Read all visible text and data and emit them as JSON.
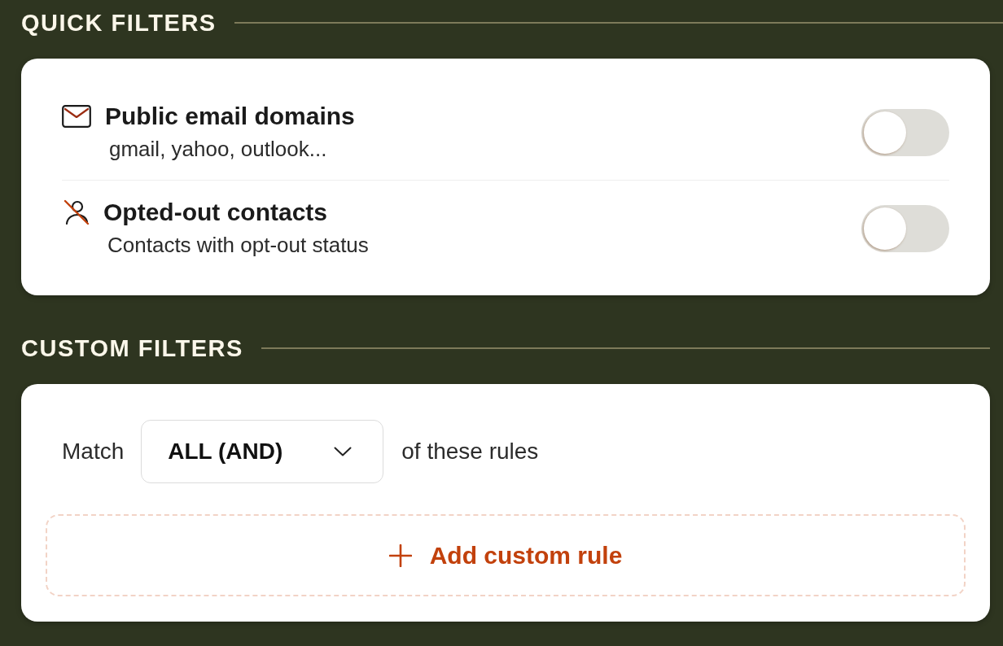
{
  "sections": [
    {
      "kind": "quick",
      "title": "QUICK FILTERS",
      "filters": [
        {
          "title": "Public email domains",
          "subtitle": "gmail, yahoo, outlook...",
          "on": false
        },
        {
          "title": "Opted-out contacts",
          "subtitle": "Contacts with opt-out status",
          "on": false
        }
      ]
    },
    {
      "kind": "custom",
      "title": "CUSTOM FILTERS",
      "match": {
        "label": "Match",
        "value": "ALL (AND)",
        "suffix": "of these rules"
      },
      "add_button": {
        "label": "Add custom rule"
      }
    }
  ]
}
